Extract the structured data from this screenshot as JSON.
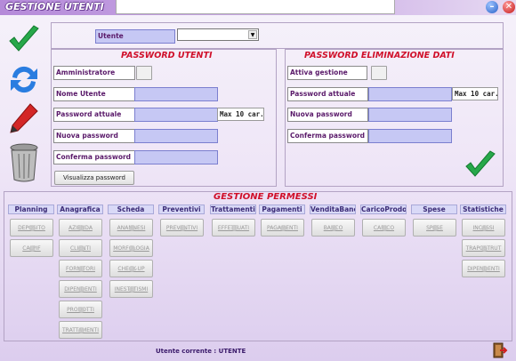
{
  "window": {
    "title": "GESTIONE UTENTI"
  },
  "user_selector": {
    "label": "Utente",
    "value": ""
  },
  "password_utenti": {
    "title": "PASSWORD UTENTI",
    "amministratore_label": "Amministratore",
    "nome_utente_label": "Nome Utente",
    "password_attuale_label": "Password attuale",
    "max_note": "Max 10 car.",
    "nuova_password_label": "Nuova password",
    "conferma_password_label": "Conferma password",
    "visualizza_button": "Visualizza password"
  },
  "password_eliminazione": {
    "title": "PASSWORD ELIMINAZIONE DATI",
    "attiva_gestione_label": "Attiva gestione",
    "password_attuale_label": "Password attuale",
    "max_note": "Max 10 car.",
    "nuova_password_label": "Nuova password",
    "conferma_password_label": "Conferma password"
  },
  "permessi": {
    "title": "GESTIONE PERMESSI",
    "columns": [
      {
        "header": "Planning",
        "items": [
          "DEPOSITO",
          "CALPIF"
        ]
      },
      {
        "header": "Anagrafica",
        "items": [
          "AZIENDA",
          "CLIENTI",
          "FORNITORI",
          "DIPENDENTI",
          "PRODOTTI",
          "TRATTAMENTI"
        ]
      },
      {
        "header": "Scheda",
        "items": [
          "ANAMNESI",
          "MORFOLOGIA",
          "CHECK-UP",
          "INESTETISMI"
        ]
      },
      {
        "header": "Preventivi",
        "items": [
          "PREVENTIVI"
        ]
      },
      {
        "header": "Trattamenti",
        "items": [
          "EFFETTUATI"
        ]
      },
      {
        "header": "Pagamenti",
        "items": [
          "PAGAMENTI"
        ]
      },
      {
        "header": "VenditaBanco",
        "items": [
          "BANCO"
        ]
      },
      {
        "header": "CaricoProdotti",
        "items": [
          "CARICO"
        ]
      },
      {
        "header": "Spese",
        "items": [
          "SPESE"
        ]
      },
      {
        "header": "Statistiche",
        "items": [
          "INCASSI",
          "TRAPOSTRUT",
          "DIPENDENTI"
        ]
      }
    ]
  },
  "status": {
    "text": "Utente corrente : UTENTE"
  },
  "icons": [
    "check-icon",
    "refresh-icon",
    "pencil-icon",
    "trash-icon",
    "confirm-check-icon",
    "exit-icon",
    "minimize-icon",
    "close-icon",
    "dropdown-arrow-icon"
  ]
}
